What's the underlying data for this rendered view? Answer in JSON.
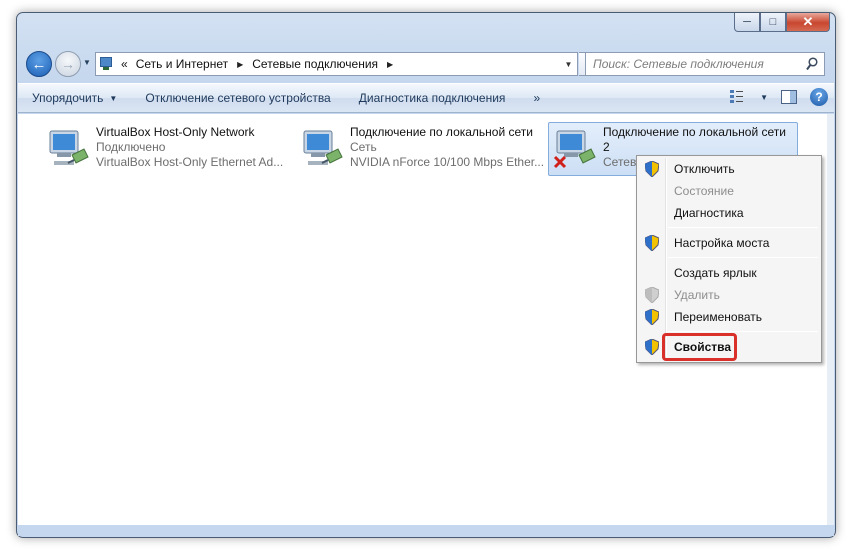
{
  "window": {
    "controls": {
      "minimize": "─",
      "maximize": "□",
      "close": "✕"
    }
  },
  "navigation": {
    "back": "←",
    "forward": "→",
    "breadcrumb_overflow": "«",
    "breadcrumb": [
      "Сеть и Интернет",
      "Сетевые подключения"
    ]
  },
  "search": {
    "placeholder": "Поиск: Сетевые подключения"
  },
  "toolbar": {
    "organize": "Упорядочить",
    "disable_device": "Отключение сетевого устройства",
    "diagnose": "Диагностика подключения",
    "more": "»"
  },
  "connections": [
    {
      "name": "VirtualBox Host-Only Network",
      "status": "Подключено",
      "adapter": "VirtualBox Host-Only Ethernet Ad...",
      "disabled": false,
      "selected": false
    },
    {
      "name": "Подключение по локальной сети",
      "status": "Сеть",
      "adapter": "NVIDIA nForce 10/100 Mbps Ether...",
      "disabled": false,
      "selected": false
    },
    {
      "name": "Подключение по локальной сети",
      "name_line2": "2",
      "status": "Сетев",
      "adapter": "",
      "disabled": true,
      "selected": true
    }
  ],
  "context_menu": {
    "items": [
      {
        "label": "Отключить",
        "shield": true,
        "enabled": true
      },
      {
        "label": "Состояние",
        "shield": false,
        "enabled": false
      },
      {
        "label": "Диагностика",
        "shield": false,
        "enabled": true
      },
      {
        "label": "Настройка моста",
        "shield": true,
        "enabled": true
      },
      {
        "label": "Создать ярлык",
        "shield": false,
        "enabled": true
      },
      {
        "label": "Удалить",
        "shield": true,
        "enabled": false
      },
      {
        "label": "Переименовать",
        "shield": true,
        "enabled": true
      },
      {
        "label": "Свойства",
        "shield": true,
        "enabled": true,
        "default": true
      }
    ]
  },
  "colors": {
    "highlight_border": "#d9302a",
    "selection": "#cddff5"
  }
}
